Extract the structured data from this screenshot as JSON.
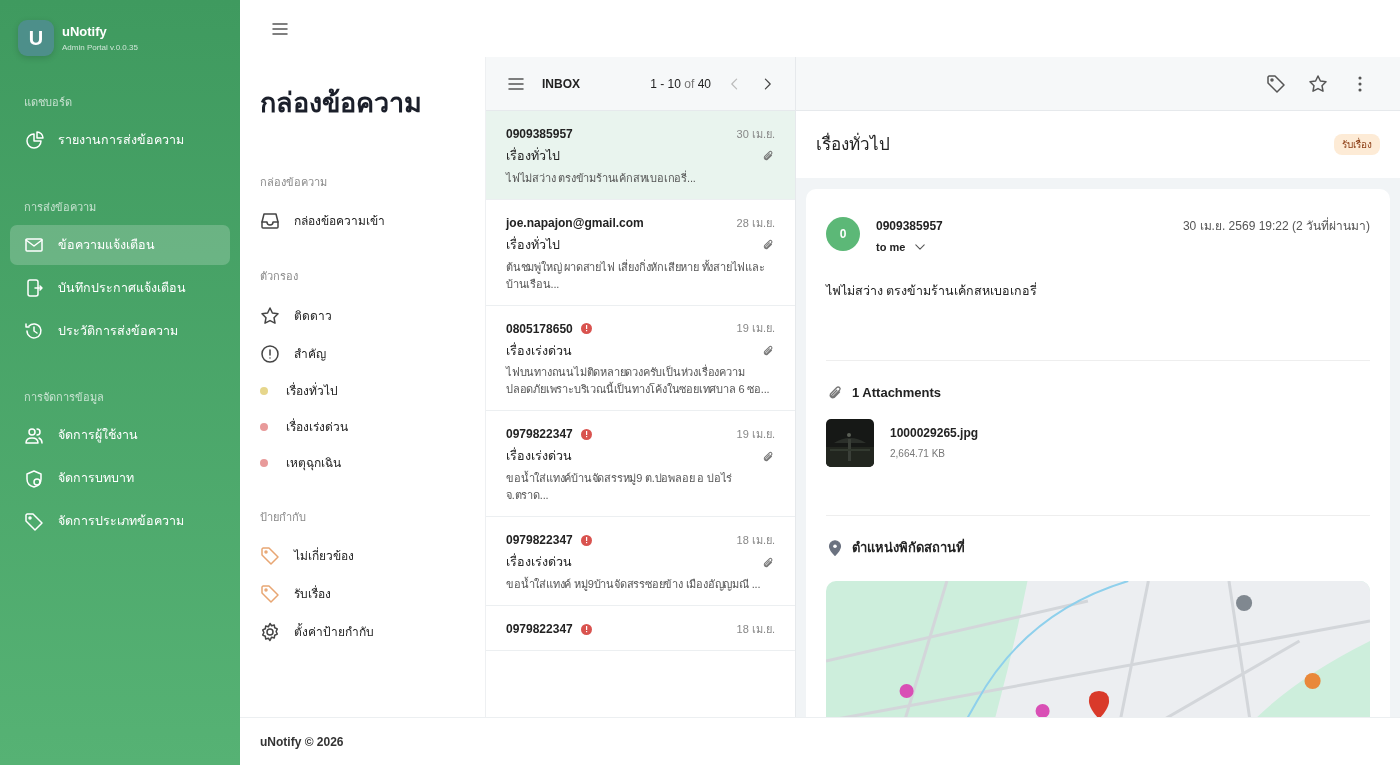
{
  "brand": {
    "logo": "U",
    "name": "uNotify",
    "subtitle": "Admin Portal v.0.0.35"
  },
  "sidebar": {
    "sections": [
      {
        "title": "แดชบอร์ด",
        "items": [
          {
            "label": "รายงานการส่งข้อความ",
            "kind": "pie",
            "selected": false
          }
        ]
      },
      {
        "title": "การส่งข้อความ",
        "items": [
          {
            "label": "ข้อความแจ้งเตือน",
            "kind": "mail",
            "selected": true
          },
          {
            "label": "บันทึกประกาศแจ้งเตือน",
            "kind": "phone",
            "selected": false
          },
          {
            "label": "ประวัติการส่งข้อความ",
            "kind": "history",
            "selected": false
          }
        ]
      },
      {
        "title": "การจัดการข้อมูล",
        "items": [
          {
            "label": "จัดการผู้ใช้งาน",
            "kind": "users",
            "selected": false
          },
          {
            "label": "จัดการบทบาท",
            "kind": "shield",
            "selected": false
          },
          {
            "label": "จัดการประเภทข้อความ",
            "kind": "tag",
            "selected": false
          }
        ]
      }
    ]
  },
  "folders": {
    "heading": "กล่องข้อความ",
    "groups": [
      {
        "title": "กล่องข้อความ",
        "items": [
          {
            "label": "กล่องข้อความเข้า",
            "kind": "inbox"
          }
        ]
      },
      {
        "title": "ตัวกรอง",
        "items": [
          {
            "label": "ติดดาว",
            "kind": "star"
          },
          {
            "label": "สำคัญ",
            "kind": "alert"
          },
          {
            "label": "เรื่องทั่วไป",
            "kind": "dot",
            "color": "#e6d68c"
          },
          {
            "label": "เรื่องเร่งด่วน",
            "kind": "dot",
            "color": "#e89a9a"
          },
          {
            "label": "เหตุฉุกเฉิน",
            "kind": "dot",
            "color": "#e89a9a"
          }
        ]
      },
      {
        "title": "ป้ายกำกับ",
        "items": [
          {
            "label": "ไม่เกี่ยวข้อง",
            "kind": "label"
          },
          {
            "label": "รับเรื่อง",
            "kind": "label"
          },
          {
            "label": "ตั้งค่าป้ายกำกับ",
            "kind": "gear"
          }
        ]
      }
    ]
  },
  "message_list": {
    "title": "INBOX",
    "range": "1 - 10",
    "of": "of",
    "total": "40",
    "messages": [
      {
        "sender": "0909385957",
        "date": "30 เม.ย.",
        "subject": "เรื่องทั่วไป",
        "preview": "ไฟไม่สว่าง ตรงข้ามร้านเค้กสหเบอเกอรี่...",
        "urgent": false,
        "attachment": true,
        "selected": true
      },
      {
        "sender": "joe.napajon@gmail.com",
        "date": "28 เม.ย.",
        "subject": "เรื่องทั่วไป",
        "preview": "ต้นชมพู่ใหญ่ ผาดสายไฟ เสี่ยงกิ่งหักเสียหาย ทั้งสายไฟและบ้านเรือน...",
        "urgent": false,
        "attachment": true,
        "selected": false
      },
      {
        "sender": "0805178650",
        "date": "19 เม.ย.",
        "subject": "เรื่องเร่งด่วน",
        "preview": "ไฟบนทางถนนไม่ติดหลายดวงครับเป็นห่วงเรื่องความปลอดภัยเพราะบริเวณนี้เป็นทางโค้งในซอยเทศบาล 6 ซอ...",
        "urgent": true,
        "attachment": true,
        "selected": false
      },
      {
        "sender": "0979822347",
        "date": "19 เม.ย.",
        "subject": "เรื่องเร่งด่วน",
        "preview": "ขอน้ำใส่แทงค์บ้านจัดสรรหมู่9 ต.บ่อพลอย อ บ่อไร่ จ.ตราด...",
        "urgent": true,
        "attachment": true,
        "selected": false
      },
      {
        "sender": "0979822347",
        "date": "18 เม.ย.",
        "subject": "เรื่องเร่งด่วน",
        "preview": "ขอน้ำใส่แทงค์ หมู่9บ้านจัดสรรซอยข้าง เมืองอัญญมณี ...",
        "urgent": true,
        "attachment": true,
        "selected": false
      },
      {
        "sender": "0979822347",
        "date": "18 เม.ย.",
        "urgent": true,
        "selected": false
      }
    ]
  },
  "detail": {
    "subject": "เรื่องทั่วไป",
    "label": "รับเรื่อง",
    "avatar": "0",
    "sender": "0909385957",
    "recipient": "to me",
    "datetime": "30 เม.ย. 2569 19:22 (2 วันที่ผ่านมา)",
    "body": "ไฟไม่สว่าง ตรงข้ามร้านเค้กสหเบอเกอรี่",
    "attachments_heading": "1 Attachments",
    "attachments": [
      {
        "name": "1000029265.jpg",
        "size": "2,664.71 KB",
        "kind": "picture"
      }
    ],
    "location_heading": "ตำแหน่งพิกัดสถานที่"
  },
  "footer": "uNotify © 2026"
}
